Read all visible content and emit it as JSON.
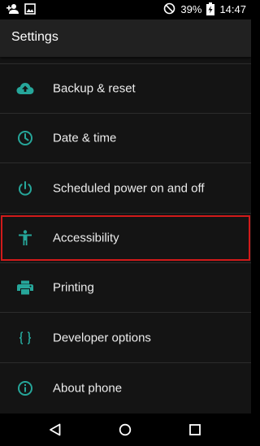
{
  "status_bar": {
    "battery_percent": "39%",
    "time": "14:47"
  },
  "app_bar": {
    "title": "Settings"
  },
  "settings_list": [
    {
      "label": "Backup & reset",
      "icon": "cloud-upload-icon"
    },
    {
      "label": "Date & time",
      "icon": "clock-icon"
    },
    {
      "label": "Scheduled power on and off",
      "icon": "power-icon"
    },
    {
      "label": "Accessibility",
      "icon": "accessibility-icon",
      "highlighted": true
    },
    {
      "label": "Printing",
      "icon": "printer-icon"
    },
    {
      "label": "Developer options",
      "icon": "braces-icon"
    },
    {
      "label": "About phone",
      "icon": "info-icon"
    }
  ],
  "colors": {
    "accent": "#26a69a",
    "highlight_border": "#d11a1a"
  }
}
